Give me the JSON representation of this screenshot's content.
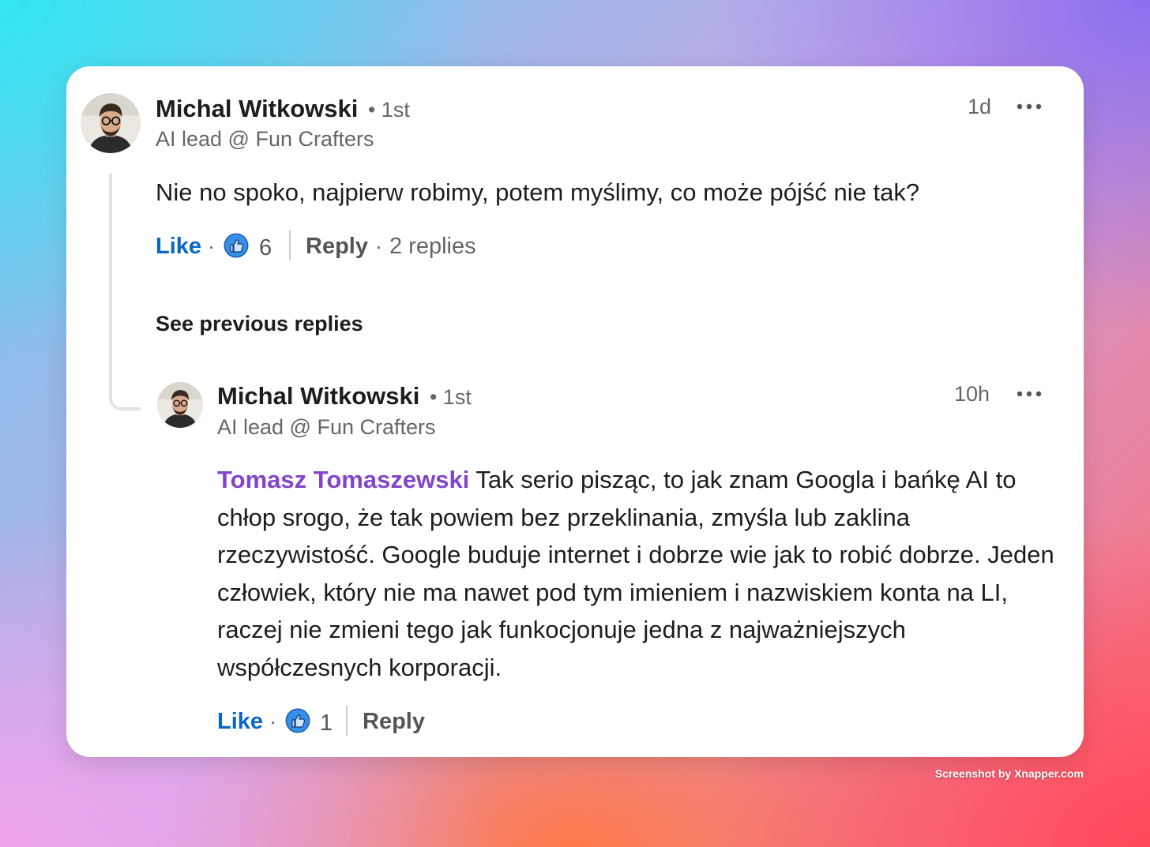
{
  "comment": {
    "author": "Michal Witkowski",
    "degree": "• 1st",
    "headline": "AI lead @ Fun Crafters",
    "time": "1d",
    "more_icon": "more-horizontal-icon",
    "text": "Nie no spoko, najpierw robimy, potem myślimy, co może pójść nie tak?",
    "like_label": "Like",
    "separator": "·",
    "reaction_icon": "thumbs-up-icon",
    "reaction_count": "6",
    "reply_label": "Reply",
    "replies_separator": "·",
    "replies_count": "2 replies"
  },
  "see_previous_replies": "See previous replies",
  "reply": {
    "author": "Michal Witkowski",
    "degree": "• 1st",
    "headline": "AI lead @ Fun Crafters",
    "time": "10h",
    "more_icon": "more-horizontal-icon",
    "mention": "Tomasz Tomaszewski",
    "text": "Tak serio pisząc, to jak znam Googla i bańkę AI to chłop srogo, że tak powiem bez przeklinania, zmyśla lub zaklina rzeczywistość. Google buduje internet i dobrze wie jak to robić dobrze. Jeden człowiek, który nie ma nawet pod tym imieniem i nazwiskiem konta na LI, raczej nie zmieni tego jak funkocjonuje jedna z najważniejszych współczesnych korporacji.",
    "like_label": "Like",
    "separator": "·",
    "reaction_icon": "thumbs-up-icon",
    "reaction_count": "1",
    "reply_label": "Reply"
  },
  "watermark": "Screenshot by Xnapper.com",
  "colors": {
    "like_blue": "#0a66c2",
    "mention_purple": "#8344cc",
    "reaction_blue": "#378fe9"
  }
}
